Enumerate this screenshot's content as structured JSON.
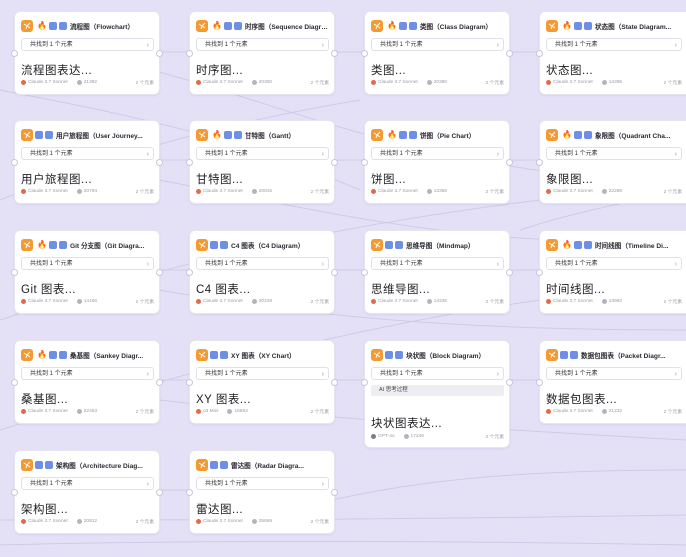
{
  "colors": {
    "background": "#e4e1f7",
    "accent": "#f39a33",
    "badge": "#6f8fe6"
  },
  "nodes": [
    {
      "title": "流程图（Flowchart）",
      "selector": "共找到 1 个元素",
      "output": "流程图表达...",
      "model": "Claude 3.7 Sonnet",
      "tokens": "21382",
      "count": "2 个元素",
      "fire": "🔥",
      "badges": 2
    },
    {
      "title": "时序图（Sequence Diagra...",
      "selector": "共找到 1 个元素",
      "output": "时序图...",
      "model": "Claude 3.7 Sonnet",
      "tokens": "20300",
      "count": "2 个元素",
      "fire": "🔥",
      "badges": 2
    },
    {
      "title": "类图（Class Diagram）",
      "selector": "共找到 1 个元素",
      "output": "类图...",
      "model": "Claude 3.7 Sonnet",
      "tokens": "20380",
      "count": "2 个元素",
      "fire": "🔥",
      "badges": 2
    },
    {
      "title": "状态图（State Diagram...",
      "selector": "共找到 1 个元素",
      "output": "状态图...",
      "model": "Claude 3.7 Sonnet",
      "tokens": "14396",
      "count": "2 个元素",
      "fire": "🔥",
      "badges": 2
    },
    {
      "title": "用户旅程图（User Journey...",
      "selector": "共找到 1 个元素",
      "output": "用户旅程图...",
      "model": "Claude 3.7 Sonnet",
      "tokens": "20794",
      "count": "2 个元素",
      "fire": "",
      "badges": 2
    },
    {
      "title": "甘特图（Gantt）",
      "selector": "共找到 1 个元素",
      "output": "甘特图...",
      "model": "Claude 3.7 Sonnet",
      "tokens": "20815",
      "count": "2 个元素",
      "fire": "🔥",
      "badges": 2
    },
    {
      "title": "饼图（Pie Chart）",
      "selector": "共找到 1 个元素",
      "output": "饼图...",
      "model": "Claude 3.7 Sonnet",
      "tokens": "13356",
      "count": "2 个元素",
      "fire": "🔥",
      "badges": 2
    },
    {
      "title": "象限图（Quadrant Cha...",
      "selector": "共找到 1 个元素",
      "output": "象限图...",
      "model": "Claude 3.7 Sonnet",
      "tokens": "22286",
      "count": "2 个元素",
      "fire": "🔥",
      "badges": 2
    },
    {
      "title": "Git 分支图（Git Diagra...",
      "selector": "共找到 1 个元素",
      "output": "Git 图表...",
      "model": "Claude 3.7 Sonnet",
      "tokens": "14166",
      "count": "2 个元素",
      "fire": "🔥",
      "badges": 2
    },
    {
      "title": "C4 图表（C4 Diagram）",
      "selector": "共找到 1 个元素",
      "output": "C4 图表...",
      "model": "Claude 3.7 Sonnet",
      "tokens": "20228",
      "count": "2 个元素",
      "fire": "",
      "badges": 2
    },
    {
      "title": "思维导图（Mindmap）",
      "selector": "共找到 1 个元素",
      "output": "思维导图...",
      "model": "Claude 3.7 Sonnet",
      "tokens": "14336",
      "count": "2 个元素",
      "fire": "",
      "badges": 2
    },
    {
      "title": "时间线图（Timeline Di...",
      "selector": "共找到 1 个元素",
      "output": "时间线图...",
      "model": "Claude 3.7 Sonnet",
      "tokens": "13983",
      "count": "2 个元素",
      "fire": "🔥",
      "badges": 2
    },
    {
      "title": "桑基图（Sankey Diagr...",
      "selector": "共找到 1 个元素",
      "output": "桑基图...",
      "model": "Claude 3.7 Sonnet",
      "tokens": "22463",
      "count": "2 个元素",
      "fire": "🔥",
      "badges": 2
    },
    {
      "title": "XY 图表（XY Chart）",
      "selector": "共找到 1 个元素",
      "output": "XY 图表...",
      "model": "o3 Mini",
      "tokens": "16653",
      "count": "2 个元素",
      "fire": "",
      "badges": 2
    },
    {
      "title": "块状图（Block Diagram）",
      "selector": "共找到 1 个元素",
      "note": "AI 思考过程",
      "output": "块状图表达...",
      "model": "GPT-4o",
      "tokens": "17246",
      "count": "2 个元素",
      "fire": "",
      "badges": 2
    },
    {
      "title": "数据包图表（Packet Diagr...",
      "selector": "共找到 1 个元素",
      "output": "数据包图表...",
      "model": "Claude 3.7 Sonnet",
      "tokens": "21232",
      "count": "2 个元素",
      "fire": "",
      "badges": 2
    },
    {
      "title": "架构图（Architecture Diag...",
      "selector": "共找到 1 个元素",
      "output": "架构图...",
      "model": "Claude 3.7 Sonnet",
      "tokens": "20812",
      "count": "2 个元素",
      "fire": "",
      "badges": 2
    },
    {
      "title": "雷达图（Radar Diagra...",
      "selector": "共找到 1 个元素",
      "output": "雷达图...",
      "model": "Claude 3.7 Sonnet",
      "tokens": "25669",
      "count": "2 个元素",
      "fire": "",
      "badges": 2
    }
  ]
}
